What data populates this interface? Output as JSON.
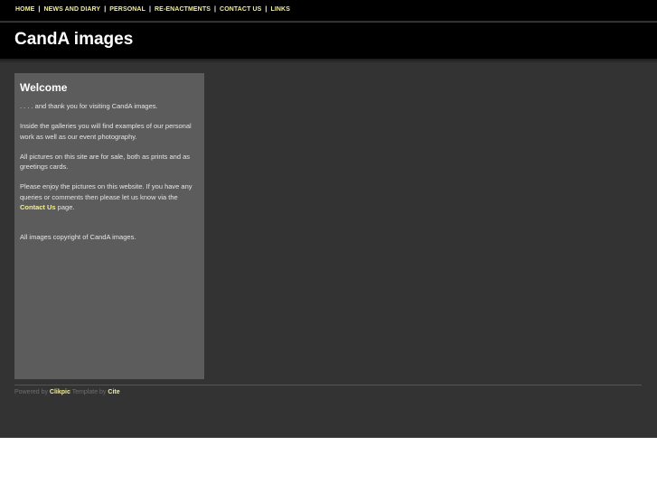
{
  "nav": {
    "items": [
      "HOME",
      "NEWS AND DIARY",
      "PERSONAL",
      "RE-ENACTMENTS",
      "CONTACT US",
      "LINKS"
    ],
    "separator": "|"
  },
  "header": {
    "title": "CandA images"
  },
  "sidebar": {
    "heading": "Welcome",
    "p1": ". . . . and thank you for visiting CandA images.",
    "p2": "Inside the galleries you will find examples of our personal work as well as our event photography.",
    "p3": "All pictures on this site are for sale, both as prints and as greetings cards.",
    "p4_before": "Please enjoy the pictures on this website. If you have any queries or comments then please let us know via the ",
    "p4_link": "Contact Us",
    "p4_after": " page.",
    "p5": "All images copyright of CandA images."
  },
  "footer": {
    "powered_by": "Powered by ",
    "clikpic": "Clikpic",
    "template_by": " Template by ",
    "cite": "Cite"
  },
  "colors": {
    "accent": "#f2ef9a",
    "background": "#333333",
    "panel": "#5c5c5c"
  }
}
